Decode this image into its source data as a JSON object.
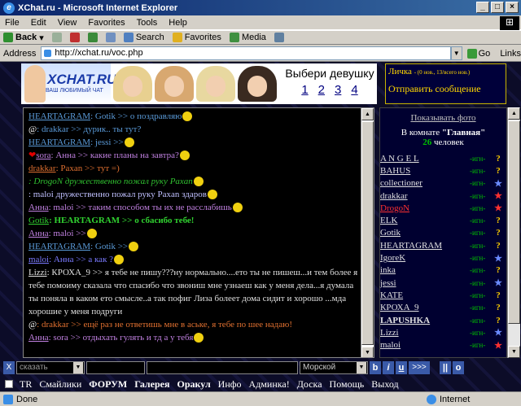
{
  "window": {
    "title": "XChat.ru - Microsoft Internet Explorer"
  },
  "menu": [
    "File",
    "Edit",
    "View",
    "Favorites",
    "Tools",
    "Help"
  ],
  "toolbar": {
    "back": "Back",
    "search": "Search",
    "favorites": "Favorites",
    "media": "Media"
  },
  "address": {
    "label": "Address",
    "url": "http://xchat.ru/voc.php",
    "go": "Go",
    "links": "Links"
  },
  "banner": {
    "brand": "XCHAT.RU",
    "slogan": "ВАШ ЛЮБИМЫЙ ЧАТ",
    "choose": "Выбери девушку",
    "numbers": [
      "1",
      "2",
      "3",
      "4"
    ]
  },
  "private": {
    "title": "Личка",
    "sub": "- (0 нов., 13/всего нов.)",
    "send": "Отправить сообщение"
  },
  "chat": [
    {
      "nick": "HEARTAGRAM",
      "nickColor": "#5a9ad8",
      "text": ": Gotik >> о поздравляю",
      "color": "#5a9ad8",
      "emo": true
    },
    {
      "nick": "",
      "text": ": drakkar >> дурик.. ты тут?",
      "color": "#5a9ad8",
      "prefix": "@"
    },
    {
      "nick": "HEARTAGRAM",
      "nickColor": "#5a9ad8",
      "text": ": jessi >>",
      "color": "#5a9ad8",
      "emo": true
    },
    {
      "nick": "sora",
      "nickColor": "#c080e0",
      "text": ": Анна >> какие планы на завтра?",
      "color": "#c080e0",
      "heart": true,
      "emo": true
    },
    {
      "nick": "drakkar",
      "nickColor": "#e07030",
      "text": ": Paxan >> тут =)",
      "color": "#e07030"
    },
    {
      "nick": "",
      "text": ": DrogoN дружественно пожал руку Paxan",
      "color": "#30c030",
      "italic": true,
      "emo": true
    },
    {
      "nick": "",
      "text": ": maloi дружественно пожал руку Paxan здаров",
      "color": "#c0c0ff",
      "emo": true
    },
    {
      "nick": "Анна",
      "nickColor": "#c080e0",
      "text": ": maloi >> таким способом ты их не расслабишь",
      "color": "#c080e0",
      "emo": true
    },
    {
      "nick": "Gotik",
      "nickColor": "#30d030",
      "text": ": HEARTAGRAM >> о сбасибо тебе!",
      "color": "#30d030",
      "bold": true
    },
    {
      "nick": "Анна",
      "nickColor": "#c080e0",
      "text": ": maloi >>",
      "color": "#c080e0",
      "emo": true
    },
    {
      "nick": "HEARTAGRAM",
      "nickColor": "#5a9ad8",
      "text": ": Gotik >>",
      "color": "#5a9ad8",
      "emo": true
    },
    {
      "nick": "",
      "text": "",
      "color": "#fff"
    },
    {
      "nick": "maloi",
      "nickColor": "#7a7aff",
      "text": ": Анна >> а как ?",
      "color": "#7a7aff",
      "emo": true
    },
    {
      "nick": "Lizzi",
      "nickColor": "#e0e0e0",
      "text": ": КРОХА_9 >> я тебе не пишу???ну нормально....ето ты не пишеш...и тем более я тебе помоиму сказала что спасибо что звониш мне узнаеш как у меня дела...я думала ты поняла в каком ето смысле..а так пофиг Лиза болеет дома сидит и хорошо ...мда хорошие у меня подруги",
      "color": "#e0e0e0",
      "wrap": true
    },
    {
      "nick": "",
      "text": ": drakkar >> ещё раз не ответишь мне в аське, я тебе по шее надаю!",
      "color": "#e07030",
      "prefix": "@"
    },
    {
      "nick": "Анна",
      "nickColor": "#c080e0",
      "text": ": sora >> отдыхать гулять и тд а у тебя",
      "color": "#c080e0",
      "emo": true
    }
  ],
  "sidebar": {
    "show_photo": "Показывать фото",
    "room_prefix": "В комнате",
    "room_name": "\"Главная\"",
    "count": "26",
    "count_label": "человек",
    "users": [
      {
        "name": "A N G E L",
        "color": "#e0e0e0",
        "tag": "-игн-",
        "sym": "?",
        "symColor": "#ffd000"
      },
      {
        "name": "BAHUS",
        "color": "#e0e0e0",
        "tag": "-игн-",
        "sym": "?",
        "symColor": "#ffd000"
      },
      {
        "name": "collectioner",
        "color": "#e0e0e0",
        "tag": "-игн-",
        "sym": "★",
        "symColor": "#6a8aff"
      },
      {
        "name": "drakkar",
        "color": "#e0e0e0",
        "tag": "-игн-",
        "sym": "★",
        "symColor": "#ff3030"
      },
      {
        "name": "DrogoN",
        "color": "#ff3030",
        "tag": "-игн-",
        "sym": "★",
        "symColor": "#ff3030"
      },
      {
        "name": "ELK",
        "color": "#e0e0e0",
        "tag": "-игн-",
        "sym": "?",
        "symColor": "#ffd000"
      },
      {
        "name": "Gotik",
        "color": "#e0e0e0",
        "tag": "-игн-",
        "sym": "?",
        "symColor": "#ffd000"
      },
      {
        "name": "HEARTAGRAM",
        "color": "#e0e0e0",
        "tag": "-игн-",
        "sym": "?",
        "symColor": "#ffd000"
      },
      {
        "name": "IgoreK",
        "color": "#e0e0e0",
        "tag": "-игн-",
        "sym": "★",
        "symColor": "#6a8aff"
      },
      {
        "name": "inka",
        "color": "#e0e0e0",
        "tag": "-игн-",
        "sym": "?",
        "symColor": "#ffd000"
      },
      {
        "name": "jessi",
        "color": "#e0e0e0",
        "tag": "-игн-",
        "sym": "★",
        "symColor": "#6a8aff"
      },
      {
        "name": "KATE",
        "color": "#e0e0e0",
        "tag": "-игн-",
        "sym": "?",
        "symColor": "#ffd000"
      },
      {
        "name": "КРОХА_9",
        "color": "#e0e0e0",
        "tag": "-игн-",
        "sym": "?",
        "symColor": "#ffd000"
      },
      {
        "name": "LAPUSHKA",
        "color": "#e0e0e0",
        "tag": "-игн-",
        "sym": "?",
        "symColor": "#ffd000",
        "bold": true
      },
      {
        "name": "Lizzi",
        "color": "#e0e0e0",
        "tag": "-игн-",
        "sym": "★",
        "symColor": "#6a8aff"
      },
      {
        "name": "maloi",
        "color": "#e0e0e0",
        "tag": "-игн-",
        "sym": "★",
        "symColor": "#ff3030"
      }
    ]
  },
  "input": {
    "mode": "сказать",
    "color": "Морской",
    "send": ">>>"
  },
  "links": [
    "TR",
    "Смайлики",
    "ФОРУМ",
    "Галерея",
    "Оракул",
    "Инфо",
    "Админка!",
    "Доска",
    "Помощь",
    "Выход"
  ],
  "status": {
    "done": "Done",
    "zone": "Internet"
  }
}
